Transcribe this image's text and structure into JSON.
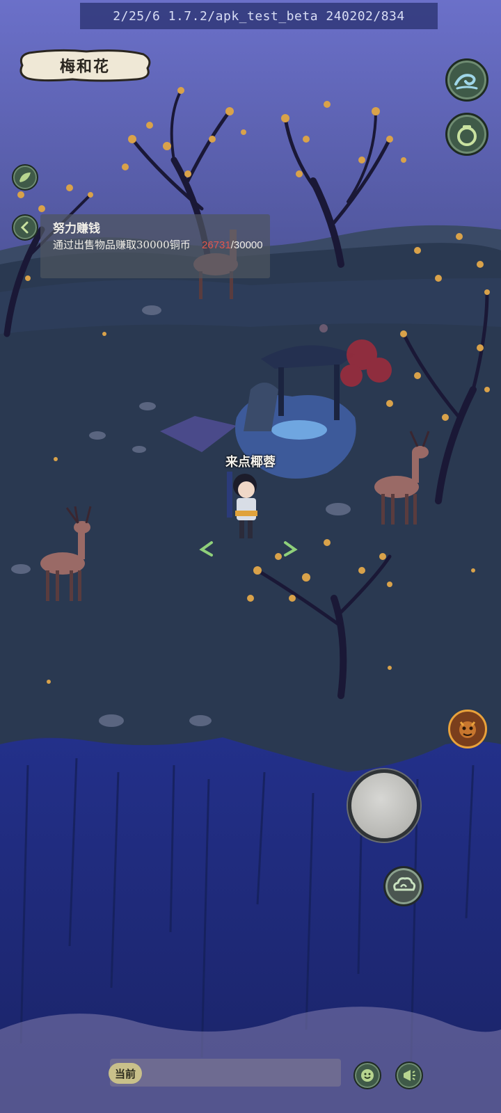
{
  "status_bar": {
    "build_info": "2/25/6   1.7.2/apk_test_beta   240202/834"
  },
  "location": {
    "name": "梅和花"
  },
  "quest": {
    "title": "努力赚钱",
    "description": "通过出售物品赚取30000铜币",
    "progress_current": "26731",
    "progress_separator": "/",
    "progress_target": "30000"
  },
  "player": {
    "name": "来点椰蓉"
  },
  "chat": {
    "channel_label": "当前"
  },
  "colors": {
    "sky": "#6a72c8",
    "ground": "#2b3a52",
    "cliff": "#1e2a7a",
    "blossom": "#d9a24a",
    "ui_green": "#3f5a48",
    "progress_red": "#e2574c"
  },
  "icons": {
    "top_right_1": "wave-icon",
    "top_right_2": "pouch-icon",
    "left_side": "leaf-icon",
    "quest_back": "chevron-left-icon",
    "monster": "monster-face-icon",
    "cloud": "cloud-swirl-icon",
    "emoji": "smile-icon",
    "send": "megaphone-icon"
  }
}
